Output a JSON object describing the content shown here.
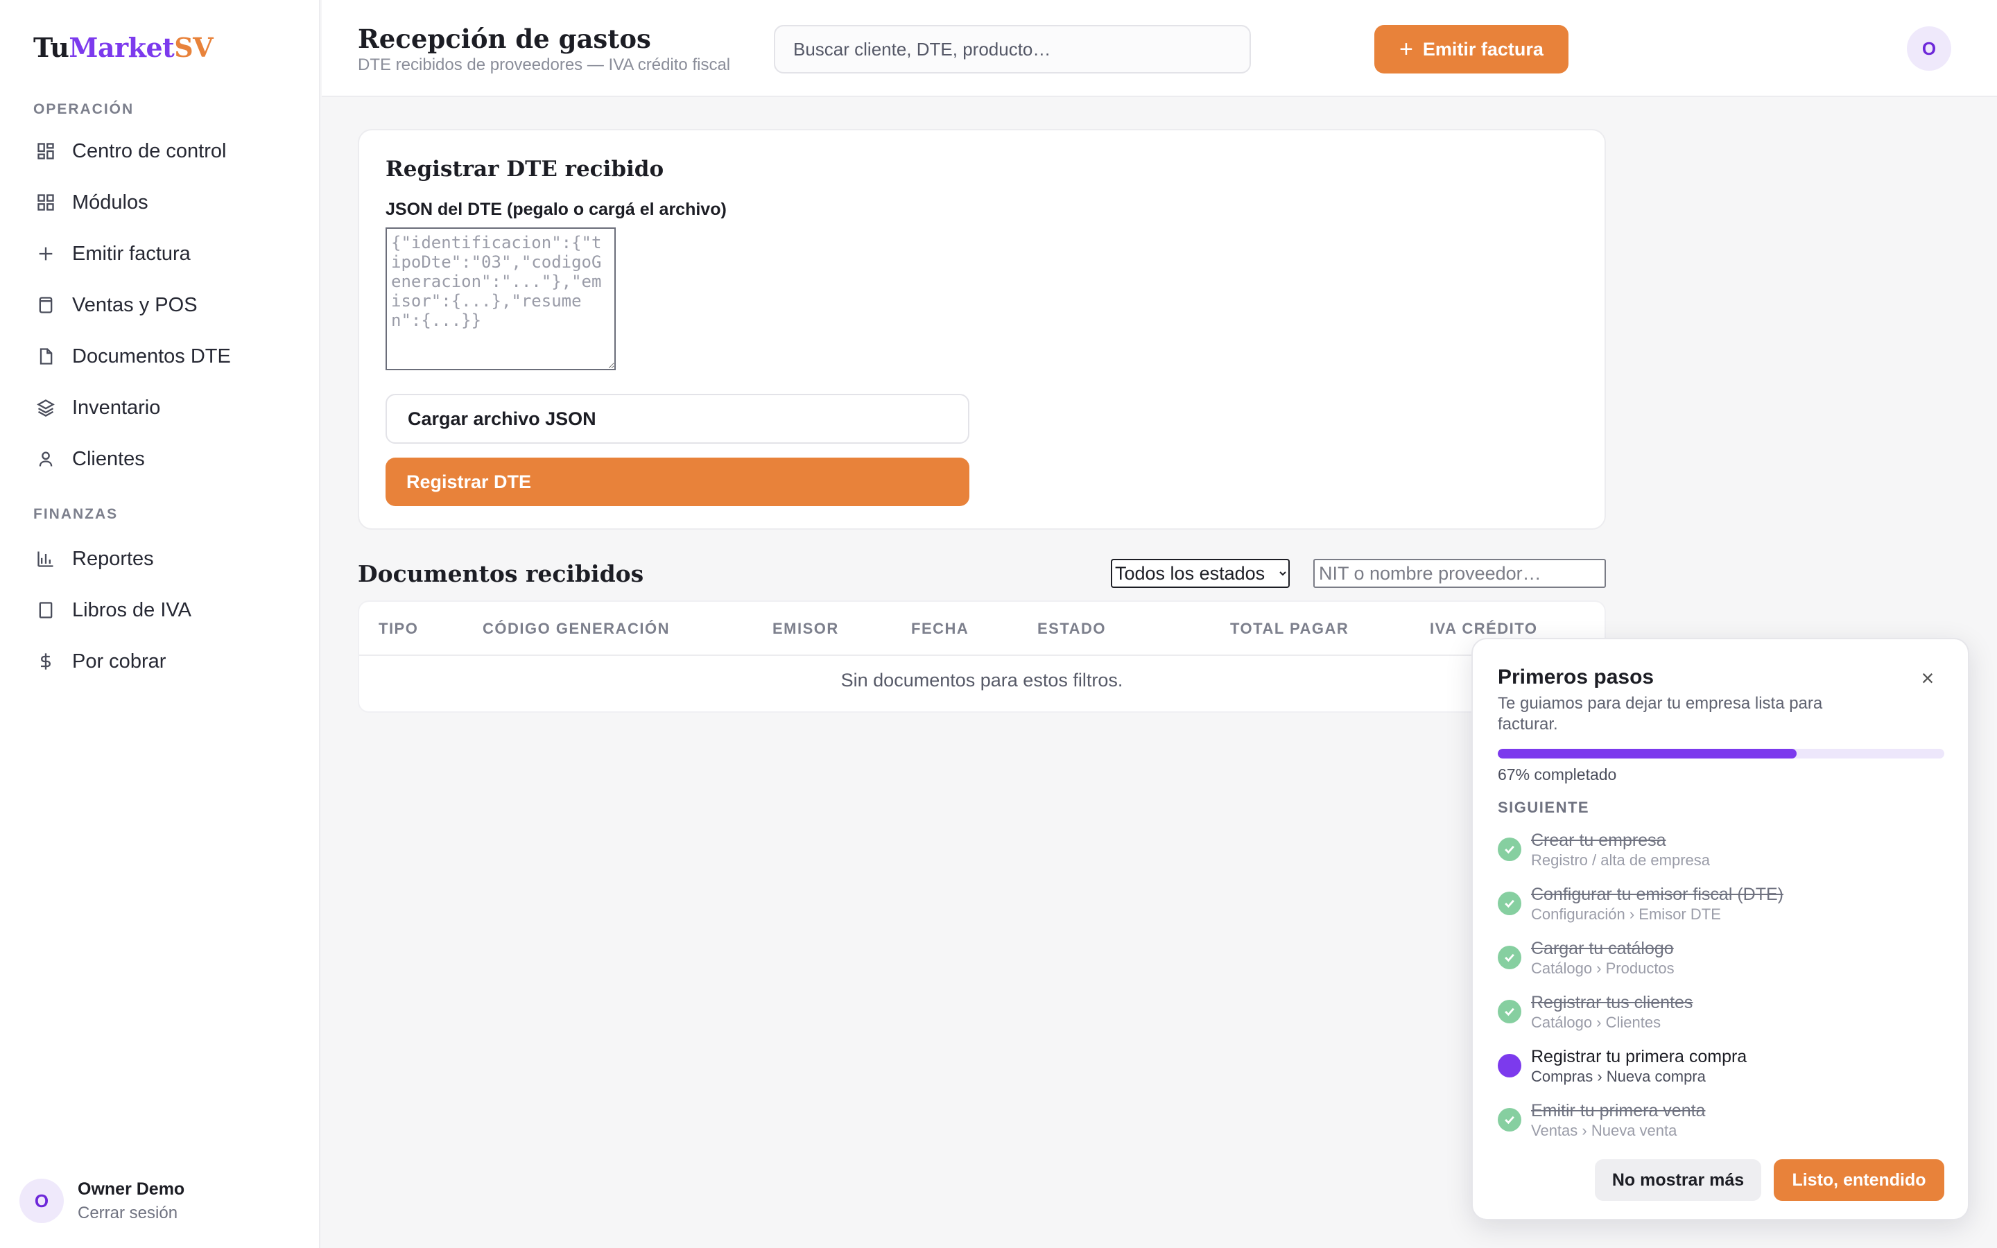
{
  "brand": {
    "part1": "Tu",
    "part2": "Market",
    "part3": "SV"
  },
  "sidebar": {
    "sections": [
      {
        "label": "OPERACIÓN"
      },
      {
        "label": "FINANZAS"
      }
    ],
    "items": [
      {
        "label": "Centro de control",
        "icon": "dashboard-icon"
      },
      {
        "label": "Módulos",
        "icon": "grid-icon"
      },
      {
        "label": "Emitir factura",
        "icon": "plus-icon"
      },
      {
        "label": "Ventas y POS",
        "icon": "receipt-icon"
      },
      {
        "label": "Documentos DTE",
        "icon": "file-icon"
      },
      {
        "label": "Inventario",
        "icon": "layers-icon"
      },
      {
        "label": "Clientes",
        "icon": "user-icon"
      },
      {
        "label": "Reportes",
        "icon": "bar-chart-icon"
      },
      {
        "label": "Libros de IVA",
        "icon": "book-icon"
      },
      {
        "label": "Por cobrar",
        "icon": "dollar-icon"
      }
    ],
    "user": {
      "initial": "O",
      "name": "Owner Demo",
      "logout": "Cerrar sesión"
    }
  },
  "header": {
    "title": "Recepción de gastos",
    "subtitle": "DTE recibidos de proveedores — IVA crédito fiscal",
    "search_placeholder": "Buscar cliente, DTE, producto…",
    "emit_button": "Emitir factura",
    "emit_icon": "+",
    "avatar_initial": "O"
  },
  "register_card": {
    "title": "Registrar DTE recibido",
    "json_label": "JSON del DTE (pegalo o cargá el archivo)",
    "json_placeholder": "{\"identificacion\":{\"tipoDte\":\"03\",\"codigoGeneracion\":\"...\"},\"emisor\":{...},\"resumen\":{...}}",
    "upload_button": "Cargar archivo JSON",
    "register_button": "Registrar DTE"
  },
  "documents": {
    "title": "Documentos recibidos",
    "state_filter": {
      "selected": "Todos los estados"
    },
    "provider_placeholder": "NIT o nombre proveedor…",
    "columns": [
      "TIPO",
      "CÓDIGO GENERACIÓN",
      "EMISOR",
      "FECHA",
      "ESTADO",
      "TOTAL PAGAR",
      "IVA CRÉDITO"
    ],
    "empty_message": "Sin documentos para estos filtros."
  },
  "onboarding": {
    "title": "Primeros pasos",
    "close_icon": "×",
    "description": "Te guiamos para dejar tu empresa lista para facturar.",
    "progress_fraction": 0.67,
    "progress_text": "67% completado",
    "next_label": "SIGUIENTE",
    "steps": [
      {
        "title": "Crear tu empresa",
        "subtitle": "Registro / alta de empresa",
        "status": "done"
      },
      {
        "title": "Configurar tu emisor fiscal (DTE)",
        "subtitle": "Configuración › Emisor DTE",
        "status": "done"
      },
      {
        "title": "Cargar tu catálogo",
        "subtitle": "Catálogo › Productos",
        "status": "done"
      },
      {
        "title": "Registrar tus clientes",
        "subtitle": "Catálogo › Clientes",
        "status": "done"
      },
      {
        "title": "Registrar tu primera compra",
        "subtitle": "Compras › Nueva compra",
        "status": "current"
      },
      {
        "title": "Emitir tu primera venta",
        "subtitle": "Ventas › Nueva venta",
        "status": "done"
      }
    ],
    "dismiss_button": "No mostrar más",
    "ok_button": "Listo, entendido"
  },
  "colors": {
    "accent": "#e8823a",
    "brand_purple": "#7c3aed",
    "done_green": "#86cfa0"
  }
}
